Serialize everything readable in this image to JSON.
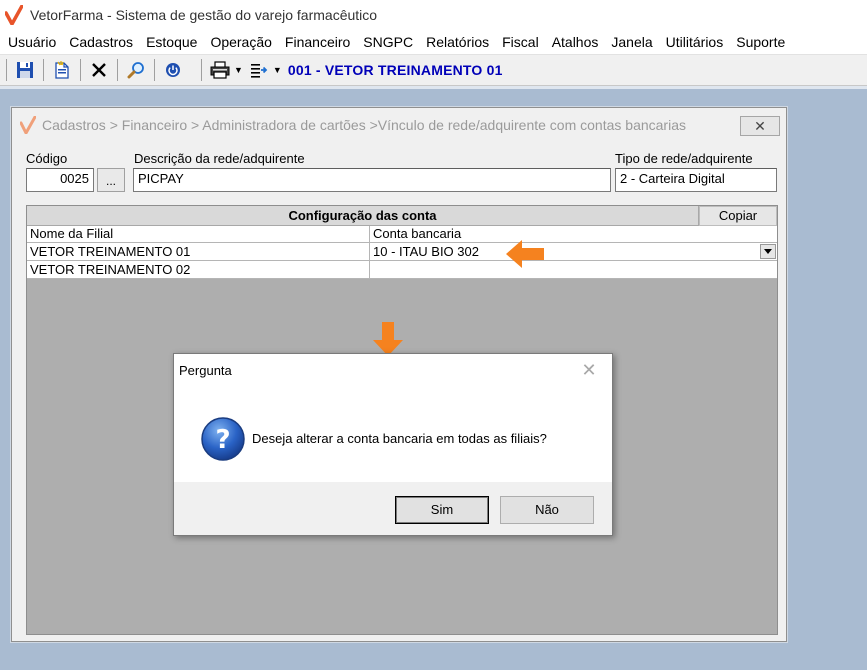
{
  "app": {
    "title": "VetorFarma - Sistema de gestão do varejo farmacêutico"
  },
  "menu": [
    "Usuário",
    "Cadastros",
    "Estoque",
    "Operação",
    "Financeiro",
    "SNGPC",
    "Relatórios",
    "Fiscal",
    "Atalhos",
    "Janela",
    "Utilitários",
    "Suporte"
  ],
  "toolbar": {
    "icons": [
      "save-icon",
      "new-document-icon",
      "delete-icon",
      "search-icon",
      "power-icon",
      "print-icon",
      "export-icon"
    ],
    "company": "001 - VETOR TREINAMENTO 01"
  },
  "window": {
    "title": "Cadastros > Financeiro > Administradora de cartões >Vínculo de rede/adquirente com contas bancarias",
    "close_label": "✕",
    "code_label": "Código",
    "code_value": "0025",
    "ellipsis_label": "...",
    "desc_label": "Descrição da rede/adquirente",
    "desc_value": "PICPAY",
    "type_label": "Tipo de rede/adquirente",
    "type_value": "2 - Carteira Digital"
  },
  "grid": {
    "band_title": "Configuração das conta",
    "copy_label": "Copiar",
    "columns": [
      "Nome da Filial",
      "Conta bancaria"
    ],
    "rows": [
      {
        "branch": "VETOR TREINAMENTO 01",
        "account": "10 - ITAU BIO 302"
      },
      {
        "branch": "VETOR TREINAMENTO 02",
        "account": ""
      }
    ]
  },
  "dialog": {
    "title": "Pergunta",
    "message": "Deseja alterar a conta bancaria em todas as filiais?",
    "yes_label": "Sim",
    "no_label": "Não"
  },
  "colors": {
    "workspace": "#a9bbd1",
    "accent_orange": "#f5821f",
    "company_blue": "#0000b8"
  }
}
